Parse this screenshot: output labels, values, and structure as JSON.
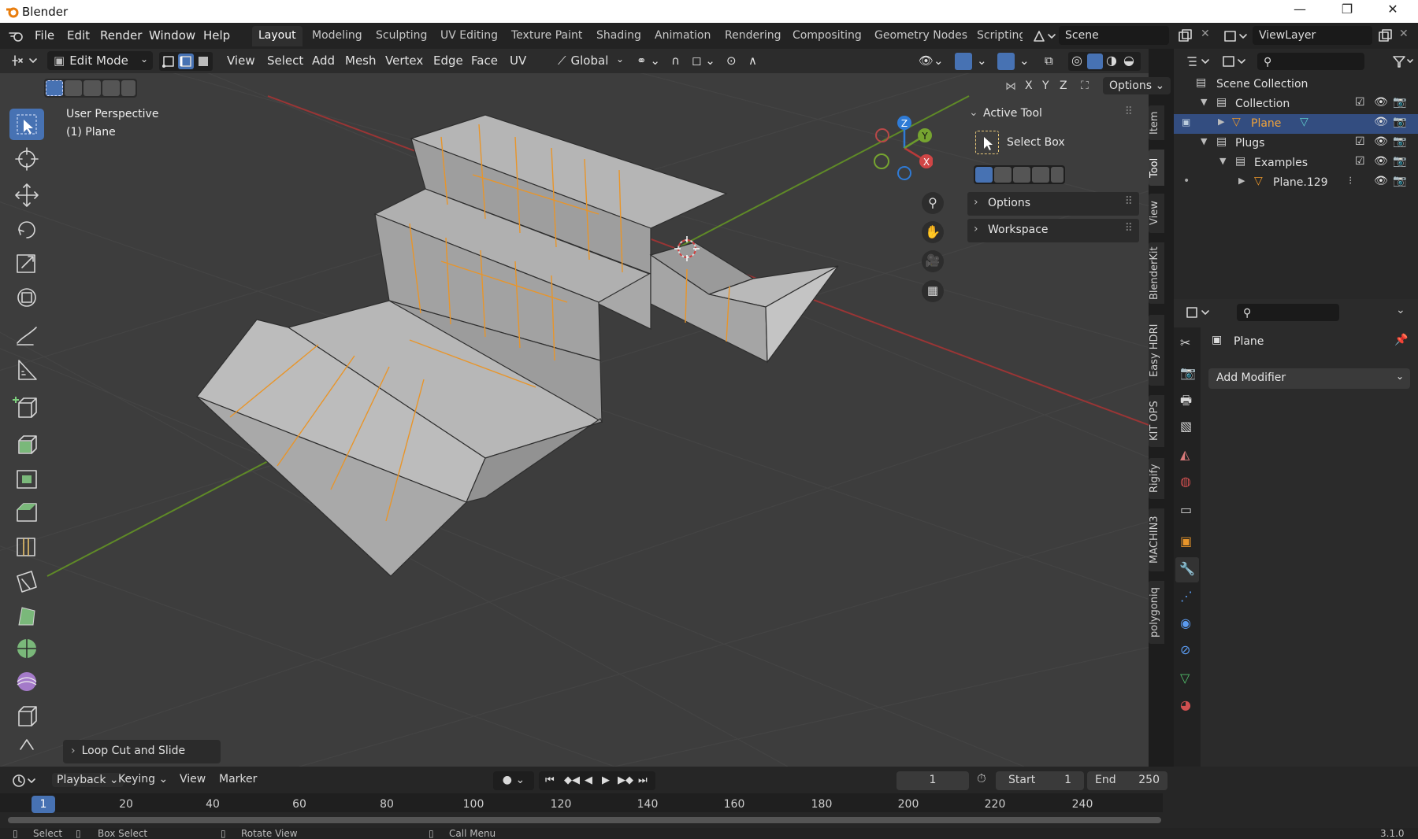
{
  "window": {
    "title": "Blender",
    "minimize": "—",
    "restore": "❐",
    "close": "✕"
  },
  "menus": [
    "File",
    "Edit",
    "Render",
    "Window",
    "Help"
  ],
  "workspaces": [
    "Layout",
    "Modeling",
    "Sculpting",
    "UV Editing",
    "Texture Paint",
    "Shading",
    "Animation",
    "Rendering",
    "Compositing",
    "Geometry Nodes",
    "Scripting"
  ],
  "scene": {
    "name": "Scene",
    "view_layer": "ViewLayer"
  },
  "viewport": {
    "mode": "Edit Mode",
    "menus": [
      "View",
      "Select",
      "Add",
      "Mesh",
      "Vertex",
      "Edge",
      "Face",
      "UV"
    ],
    "transform_orientation": "Global",
    "overlay_text": "User Perspective",
    "object_text": "(1) Plane",
    "axis_labels": [
      "X",
      "Y",
      "Z"
    ],
    "options_label": "Options",
    "gizmo": {
      "x": "X",
      "y": "Y",
      "z": "Z"
    },
    "last_operator": "Loop Cut and Slide"
  },
  "npanel": {
    "active_tool_header": "Active Tool",
    "tool_name": "Select Box",
    "options": "Options",
    "workspace": "Workspace",
    "tabs": [
      "Item",
      "Tool",
      "View",
      "BlenderKit",
      "Easy HDRI",
      "KIT OPS",
      "Rigify",
      "MACHIN3",
      "polygoniq"
    ]
  },
  "outliner": {
    "root": "Scene Collection",
    "rows": [
      {
        "label": "Collection"
      },
      {
        "label": "Plane"
      },
      {
        "label": "Plugs"
      },
      {
        "label": "Examples"
      },
      {
        "label": "Plane.129"
      }
    ]
  },
  "properties": {
    "object_name": "Plane",
    "add_modifier": "Add Modifier"
  },
  "timeline": {
    "menus": [
      "Playback",
      "Keying",
      "View",
      "Marker"
    ],
    "current_frame": "1",
    "start_label": "Start",
    "start": "1",
    "end_label": "End",
    "end": "250",
    "ruler": [
      "1",
      "20",
      "40",
      "60",
      "80",
      "100",
      "120",
      "140",
      "160",
      "180",
      "200",
      "220",
      "240"
    ]
  },
  "statusbar": {
    "select": "Select",
    "box_select": "Box Select",
    "rotate": "Rotate View",
    "call_menu": "Call Menu",
    "version": "3.1.0"
  },
  "colors": {
    "accent": "#4772b3",
    "edge_selected": "#e8952a",
    "x_axis": "#b83a3a",
    "y_axis": "#6b9a2c",
    "z_axis": "#2f7bd6"
  }
}
